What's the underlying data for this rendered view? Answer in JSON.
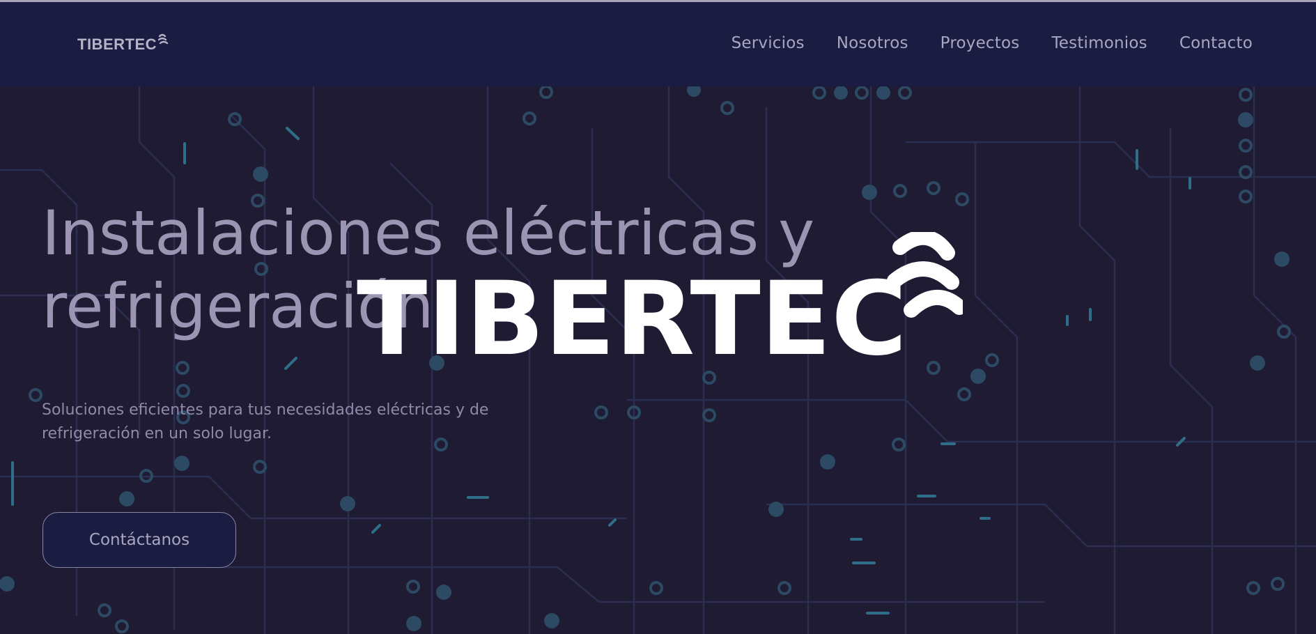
{
  "nav": {
    "brand": "TIBERTEC",
    "brand_icon": "tibertec-wave-icon",
    "links": [
      "Servicios",
      "Nosotros",
      "Proyectos",
      "Testimonios",
      "Contacto"
    ]
  },
  "hero": {
    "title_line1": "Instalaciones eléctricas y",
    "title_line2": "refrigeración",
    "subtitle_line1": "Soluciones eficientes para tus necesidades eléctricas y de",
    "subtitle_line2": "refrigeración en un solo lugar.",
    "cta_label": "Contáctanos"
  },
  "overlay_logo": {
    "text": "TIBERTEC",
    "icon": "tibertec-wave-icon"
  },
  "colors": {
    "navbar_bg": "#1b1c42",
    "hero_bg": "#1f1b33",
    "circuit": "#2c4a63",
    "circuit_glow": "#2f6e88",
    "title": "#9b94b3",
    "logo": "#ffffff"
  }
}
